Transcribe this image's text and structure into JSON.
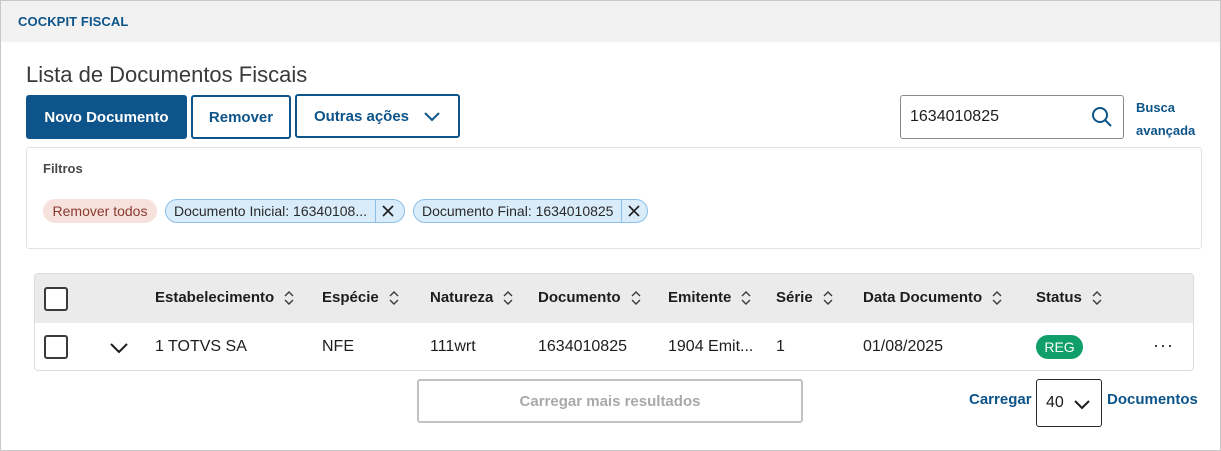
{
  "topbar": {
    "breadcrumb": "COCKPIT FISCAL"
  },
  "page": {
    "title": "Lista de Documentos Fiscais"
  },
  "toolbar": {
    "new_label": "Novo Documento",
    "remove_label": "Remover",
    "more_label": "Outras ações"
  },
  "search": {
    "value": "1634010825",
    "advanced_label_1": "Busca",
    "advanced_label_2": "avançada"
  },
  "filters": {
    "label": "Filtros",
    "remove_all": "Remover todos",
    "tags": [
      {
        "label": "Documento Inicial: 16340108..."
      },
      {
        "label": "Documento Final: 1634010825"
      }
    ]
  },
  "table": {
    "columns": [
      "Estabelecimento",
      "Espécie",
      "Natureza",
      "Documento",
      "Emitente",
      "Série",
      "Data Documento",
      "Status"
    ],
    "rows": [
      {
        "estabelecimento": "1 TOTVS SA",
        "especie": "NFE",
        "natureza": "111wrt",
        "documento": "1634010825",
        "emitente": "1904 Emit...",
        "serie": "1",
        "data": "01/08/2025",
        "status": "REG",
        "actions": "···"
      }
    ]
  },
  "pagination": {
    "load_more": "Carregar mais resultados",
    "load_label": "Carregar",
    "page_size": "40",
    "docs_label": "Documentos"
  },
  "colors": {
    "primary": "#0c5489",
    "status_green": "#109e6a",
    "remove_all_bg": "#f7e1dd",
    "tag_bg": "#d9ecfa"
  },
  "icons": {
    "search": "search-icon",
    "chevron": "chevron-down-icon",
    "sort": "sort-icon",
    "close": "close-icon",
    "more": "more-horizontal-icon"
  }
}
